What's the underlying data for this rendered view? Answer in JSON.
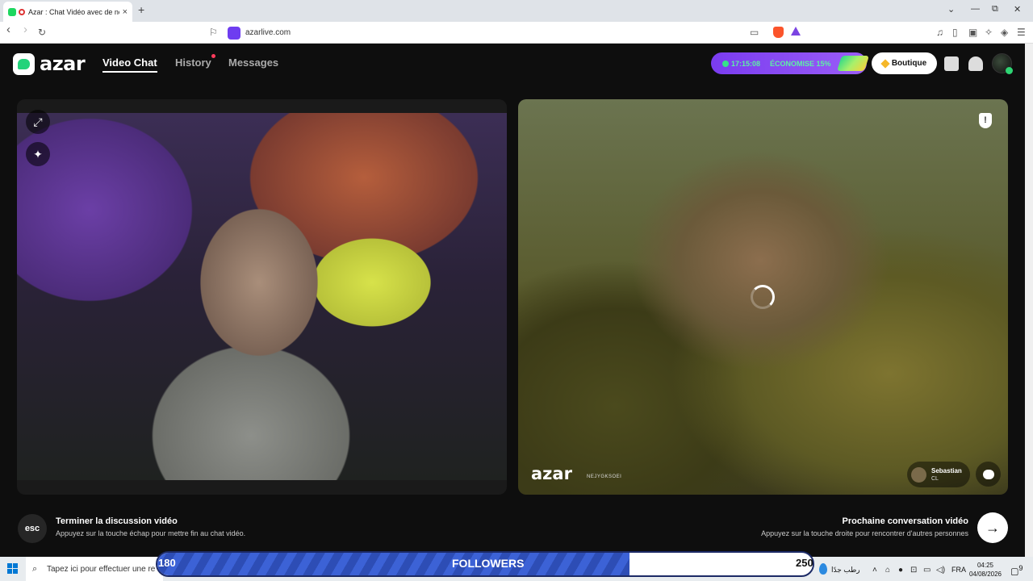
{
  "browser": {
    "tab_title": "Azar : Chat Vidéo avec de no",
    "tab_close": "×",
    "new_tab": "+",
    "url": "azarlive.com",
    "back": "‹",
    "forward": "›",
    "reload": "↻",
    "win_min": "—",
    "win_max": "⧉",
    "win_close": "✕"
  },
  "header": {
    "logo": "azar",
    "nav": [
      "Video Chat",
      "History",
      "Messages"
    ],
    "promo_time": "17:15:08",
    "promo_text": "ÉCONOMISE 15%",
    "shop": "Boutique"
  },
  "left_panel": {
    "expand_icon": "⤢",
    "magic_icon": "✦"
  },
  "right_panel": {
    "report_icon": "!",
    "watermark": "azar",
    "watermark_id": "NEJYGKSOEI",
    "peer_name": "Sebastian",
    "peer_country": "CL"
  },
  "controls": {
    "esc_label": "esc",
    "end_title": "Terminer la discussion vidéo",
    "end_sub": "Appuyez sur la touche échap pour mettre fin au chat vidéo.",
    "next_title": "Prochaine conversation vidéo",
    "next_sub": "Appuyez sur la touche droite pour rencontrer d'autres personnes",
    "next_icon": "→"
  },
  "taskbar": {
    "search_placeholder": "Tapez ici pour effectuer une re",
    "followers_start": "180",
    "followers_label": "FOLLOWERS",
    "followers_end": "250",
    "followers_progress": 0.72,
    "weather_text": "رطب جدًا",
    "lang": "FRA",
    "time": "04:25",
    "date": "04/08/2026",
    "notifications": "9"
  },
  "colors": {
    "accent_purple": "#7a3cf0",
    "accent_green": "#22d37a",
    "followers_blue": "#3c62d6"
  }
}
